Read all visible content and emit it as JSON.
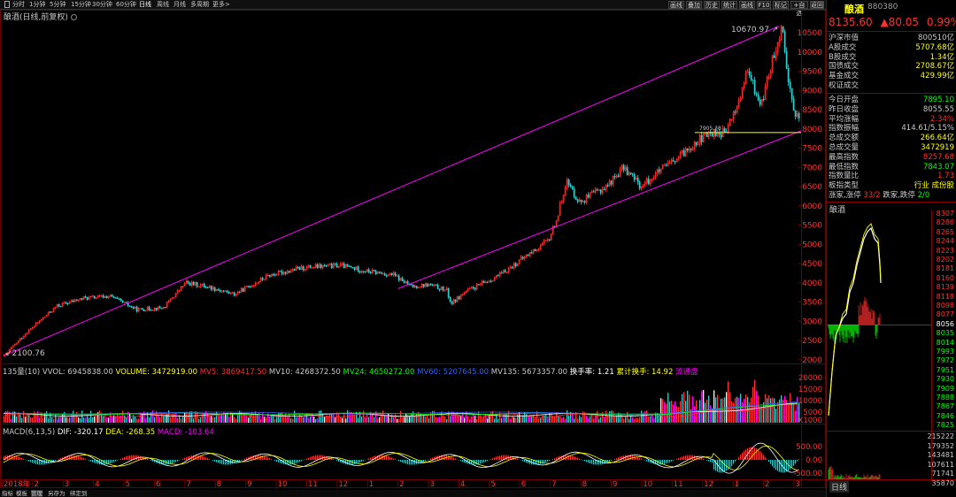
{
  "toolbar": {
    "periods": [
      "分时",
      "1分钟",
      "5分钟",
      "15分钟",
      "30分钟",
      "60分钟",
      "日线",
      "周线",
      "月线",
      "多周期",
      "更多>"
    ],
    "active_period": "日线",
    "actions": [
      "画线",
      "叠加",
      "历史",
      "统计",
      "画线",
      "F10",
      "标记",
      "+自选",
      "返回"
    ]
  },
  "chart": {
    "title": "酿酒(日线,前复权)",
    "high_label": "10670.97",
    "low_label": "2100.76",
    "line_label": "7905.38",
    "y_ticks": [
      "10500",
      "10000",
      "9500",
      "9000",
      "8500",
      "8000",
      "7500",
      "7000",
      "6500",
      "6000",
      "5500",
      "5000",
      "4500",
      "4000",
      "3500",
      "3000",
      "2500",
      "2000"
    ],
    "x_ticks": [
      "2018年",
      "2",
      "3",
      "4",
      "5",
      "6",
      "7",
      "8",
      "9",
      "10",
      "11",
      "12",
      "1",
      "2",
      "3",
      "4",
      "5",
      "6",
      "7",
      "8",
      "9",
      "10",
      "11",
      "12",
      "1",
      "2",
      "3"
    ],
    "colors": {
      "up": "#ff3333",
      "down": "#33cccc",
      "trend": "#ff00ff",
      "support": "#ffff00",
      "grid": "#6b0000"
    }
  },
  "volume_panel": {
    "label": "135量(10)",
    "vvol": "VVOL: 6945838.00",
    "volume": "VOLUME: 3472919.00",
    "mv5": "MV5: 3869417.50",
    "mv10": "MV10: 4268372.50",
    "mv24": "MV24: 4650272.00",
    "mv60": "MV60: 5207645.00",
    "mv135": "MV135: 5673357.00",
    "turnover": "换手率: 1.21",
    "cum_turnover": "累计换手: 14.92",
    "float": "流通盘",
    "y_ticks": [
      "20000",
      "15000",
      "10000",
      "5000",
      "X1000"
    ]
  },
  "macd_panel": {
    "label": "MACD(6,13,5)",
    "dif": "DIF: -320.17",
    "dea": "DEA: -268.35",
    "macd": "MACD: -103.64",
    "y_ticks": [
      "500.00",
      "0.00",
      "-500.00"
    ]
  },
  "bottom_tabs": [
    "指标",
    "模板",
    "管理",
    "另存为",
    "绑定到"
  ],
  "quote": {
    "name": "酿酒",
    "code": "880380",
    "price": "8135.60",
    "change": "▲80.05",
    "percent": "0.99%",
    "rows": [
      {
        "k": "沪深市值",
        "v": "800510亿",
        "c": "#c8c8c8"
      },
      {
        "k": "A股成交",
        "v": "5707.68亿",
        "c": "#ffff00"
      },
      {
        "k": "B股成交",
        "v": "1.34亿",
        "c": "#ffff00"
      },
      {
        "k": "国债成交",
        "v": "2708.67亿",
        "c": "#ffff00"
      },
      {
        "k": "基金成交",
        "v": "429.99亿",
        "c": "#ffff00"
      },
      {
        "k": "权证成交",
        "v": "",
        "c": "#ffff00"
      },
      {
        "k": "今日开盘",
        "v": "7895.10",
        "c": "#00ff00"
      },
      {
        "k": "昨日收盘",
        "v": "8055.55",
        "c": "#c8c8c8"
      },
      {
        "k": "平均涨幅",
        "v": "2.34%",
        "c": "#ff3030"
      },
      {
        "k": "指数振幅",
        "v": "414.61/5.15%",
        "c": "#c8c8c8"
      },
      {
        "k": "总成交额",
        "v": "266.64亿",
        "c": "#ffff00"
      },
      {
        "k": "总成交量",
        "v": "3472919",
        "c": "#ffff00"
      },
      {
        "k": "最高指数",
        "v": "8257.68",
        "c": "#ff3030"
      },
      {
        "k": "最低指数",
        "v": "7843.07",
        "c": "#00ff00"
      },
      {
        "k": "指数量比",
        "v": "1.73",
        "c": "#ff3030"
      }
    ],
    "sector": {
      "k": "板指类型",
      "v": "行业 成份股",
      "c": "#ffff00"
    },
    "rise_fall": {
      "k": "涨家,涨停",
      "v1": "33/2",
      "k2": "跌家,跌停",
      "v2": "2/0"
    },
    "intraday_title": "酿酒",
    "intraday_scale": [
      "8307",
      "8286",
      "8265",
      "8244",
      "8223",
      "8202",
      "8181",
      "8160",
      "8139",
      "8118",
      "8098",
      "8077",
      "8056",
      "8035",
      "8014",
      "7993",
      "7972",
      "7951",
      "7930",
      "7909",
      "7888",
      "7867",
      "7846",
      "7825"
    ],
    "intraday_vol_scale": [
      "215222",
      "179352",
      "143481",
      "107611",
      "71741",
      "35870"
    ],
    "bottom_label": "日线"
  }
}
